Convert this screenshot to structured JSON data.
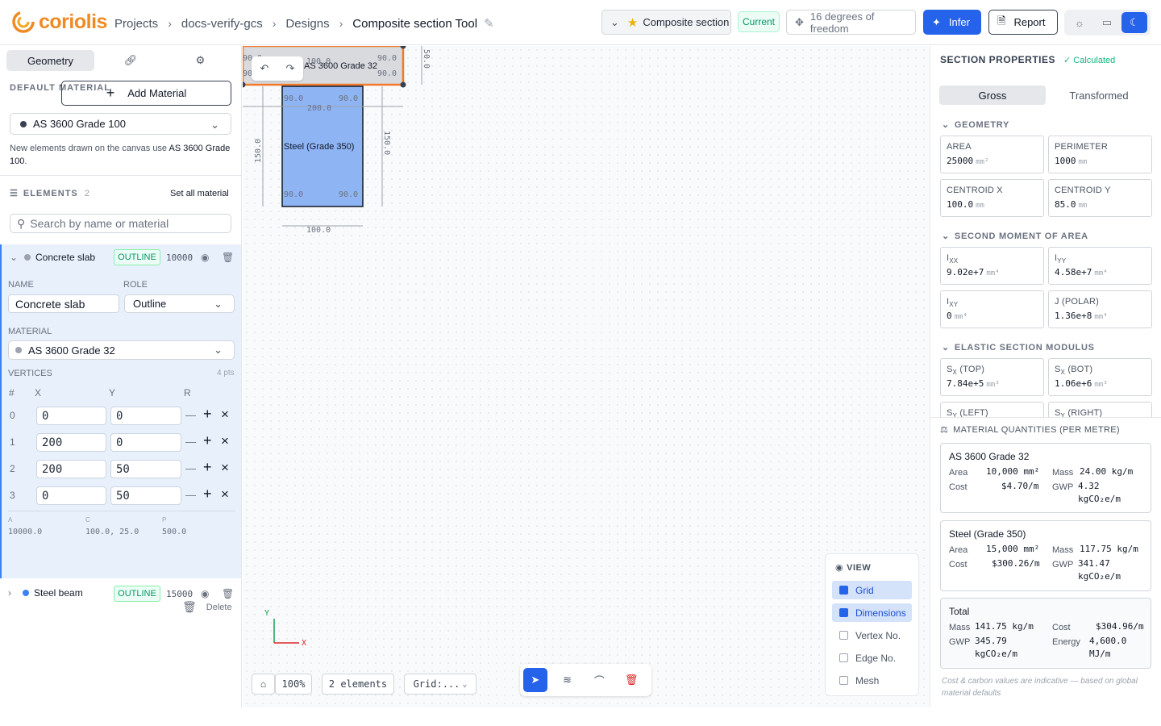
{
  "brand": {
    "name": "coriolis"
  },
  "breadcrumb": {
    "items": [
      "Projects",
      "docs-verify-gcs",
      "Designs"
    ],
    "current": "Composite section Tool"
  },
  "header": {
    "section_type": "Composite section",
    "status_badge": "Current",
    "dof_label": "16 degrees of freedom",
    "infer_label": "Infer",
    "report_label": "Report",
    "theme_selected": "dark"
  },
  "left": {
    "tabs": [
      "Geometry",
      "link",
      "settings"
    ],
    "default_material_label": "DEFAULT MATERIAL",
    "add_material_label": "Add Material",
    "default_material_value": "AS 3600 Grade 100",
    "note_prefix": "New elements drawn on the canvas use ",
    "note_material": "AS 3600 Grade 100",
    "note_suffix": ".",
    "elements_label": "ELEMENTS",
    "elements_count": "2",
    "set_all_label": "Set all material",
    "search_placeholder": "Search by name or material",
    "elements": [
      {
        "name": "Concrete slab",
        "role_badge": "OUTLINE",
        "area": "10000",
        "color": "#9ca3af",
        "expanded": true
      },
      {
        "name": "Steel beam",
        "role_badge": "OUTLINE",
        "area": "15000",
        "color": "#3b82f6",
        "expanded": false
      }
    ],
    "editor": {
      "name_label": "NAME",
      "role_label": "ROLE",
      "name_value": "Concrete slab",
      "role_value": "Outline",
      "material_label": "MATERIAL",
      "material_value": "AS 3600 Grade 32",
      "vertices_label": "VERTICES",
      "vertices_count": "4 pts",
      "col_idx": "#",
      "col_x": "X",
      "col_y": "Y",
      "col_r": "R",
      "vertices": [
        {
          "i": "0",
          "x": "0",
          "y": "0"
        },
        {
          "i": "1",
          "x": "200",
          "y": "0"
        },
        {
          "i": "2",
          "x": "200",
          "y": "50"
        },
        {
          "i": "3",
          "x": "0",
          "y": "50"
        }
      ],
      "stats": {
        "a_label": "A",
        "a": "10000.0",
        "c_label": "C",
        "c": "100.0, 25.0",
        "p_label": "P",
        "p": "500.0"
      },
      "delete_label": "Delete"
    }
  },
  "canvas": {
    "slab_label": "AS 3600 Grade 32",
    "beam_label": "Steel (Grade 350)",
    "dims": {
      "slab_w": "200.0",
      "slab_h": "50.0",
      "beam_w": "200.0",
      "beam_h": "150.0",
      "beam_h2": "150.0",
      "beam_bot": "100.0",
      "slab_inner": "100.0",
      "angle": "90.0"
    },
    "axis": {
      "x": "X",
      "y": "Y"
    },
    "zoom": "100%",
    "elements_chip": "2 elements",
    "grid_chip": "Grid:...",
    "view": {
      "title": "VIEW",
      "options": [
        {
          "label": "Grid",
          "on": true
        },
        {
          "label": "Dimensions",
          "on": true
        },
        {
          "label": "Vertex No.",
          "on": false
        },
        {
          "label": "Edge No.",
          "on": false
        },
        {
          "label": "Mesh",
          "on": false
        }
      ]
    }
  },
  "right": {
    "title": "SECTION PROPERTIES",
    "status": "Calculated",
    "tabs": [
      "Gross",
      "Transformed"
    ],
    "geometry_title": "GEOMETRY",
    "area_label": "AREA",
    "area": "25000",
    "area_unit": "mm²",
    "perim_label": "PERIMETER",
    "perim": "1000",
    "perim_unit": "mm",
    "cx_label": "CENTROID X",
    "cx": "100.0",
    "cx_unit": "mm",
    "cy_label": "CENTROID Y",
    "cy": "85.0",
    "cy_unit": "mm",
    "sma_title": "SECOND MOMENT OF AREA",
    "ixx_label": "I",
    "ixx_sub": "XX",
    "ixx": "9.02e+7",
    "ixx_unit": "mm⁴",
    "iyy_label": "I",
    "iyy_sub": "YY",
    "iyy": "4.58e+7",
    "iyy_unit": "mm⁴",
    "ixy_label": "I",
    "ixy_sub": "XY",
    "ixy": "0",
    "ixy_unit": "mm⁴",
    "j_label": "J (POLAR)",
    "j": "1.36e+8",
    "j_unit": "mm⁴",
    "esm_title": "ELASTIC SECTION MODULUS",
    "sxt_label": "S",
    "sxt_sub": "X",
    "sxt_tail": " (TOP)",
    "sxt": "7.84e+5",
    "sxt_unit": "mm³",
    "sxb_label": "S",
    "sxb_sub": "X",
    "sxb_tail": " (BOT)",
    "sxb": "1.06e+6",
    "sxb_unit": "mm³",
    "syl_label": "S",
    "syl_sub": "Y",
    "syl_tail": " (LEFT)",
    "syr_label": "S",
    "syr_sub": "Y",
    "syr_tail": " (RIGHT)",
    "mq_title": "MATERIAL QUANTITIES (PER METRE)",
    "materials": [
      {
        "name": "AS 3600 Grade 32",
        "area": "10,000 mm²",
        "mass": "24.00 kg/m",
        "cost": "$4.70/m",
        "gwp1": "4.32",
        "gwp2": "kgCO₂e/m"
      },
      {
        "name": "Steel (Grade 350)",
        "area": "15,000 mm²",
        "mass": "117.75 kg/m",
        "cost": "$300.26/m",
        "gwp1": "341.47",
        "gwp2": "kgCO₂e/m"
      }
    ],
    "total": {
      "title": "Total",
      "mass": "141.75 kg/m",
      "cost": "$304.96/m",
      "gwp1": "345.79",
      "gwp2": "kgCO₂e/m",
      "energy1": "4,600.0",
      "energy2": "MJ/m"
    },
    "labels": {
      "area": "Area",
      "mass": "Mass",
      "cost": "Cost",
      "gwp": "GWP",
      "energy": "Energy"
    },
    "disclaimer": "Cost & carbon values are indicative — based on global material defaults"
  }
}
